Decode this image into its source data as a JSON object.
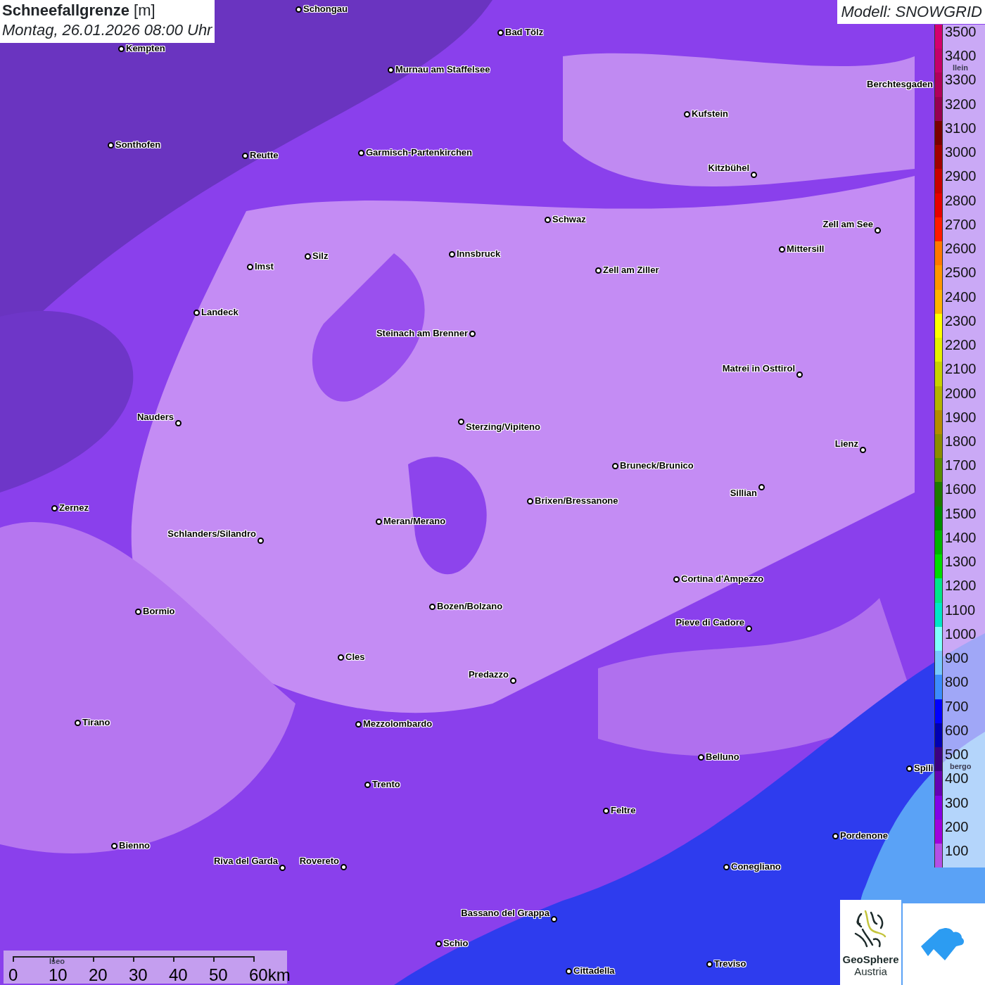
{
  "header": {
    "title": "**Schneefallgrenze** [m]",
    "subtitle": "Montag, 26.01.2026 08:00 Uhr"
  },
  "model": "Modell: SNOWGRID",
  "cities": [
    {
      "name": "Schongau"
    },
    {
      "name": "Kempten"
    },
    {
      "name": "Bad Tölz"
    },
    {
      "name": "Murnau am Staffelsee"
    },
    {
      "name": "Berchtesgaden"
    },
    {
      "name": "Kufstein"
    },
    {
      "name": "Sonthofen"
    },
    {
      "name": "Reutte"
    },
    {
      "name": "Garmisch-Partenkirchen"
    },
    {
      "name": "Kitzbühel"
    },
    {
      "name": "Schwaz"
    },
    {
      "name": "Zell am See"
    },
    {
      "name": "Mittersill"
    },
    {
      "name": "Innsbruck"
    },
    {
      "name": "Silz"
    },
    {
      "name": "Imst"
    },
    {
      "name": "Zell am Ziller"
    },
    {
      "name": "Landeck"
    },
    {
      "name": "Steinach am Brenner"
    },
    {
      "name": "Matrei in Osttirol"
    },
    {
      "name": "Nauders"
    },
    {
      "name": "Sterzing/Vipiteno"
    },
    {
      "name": "Lienz"
    },
    {
      "name": "Bruneck/Brunico"
    },
    {
      "name": "Sillian"
    },
    {
      "name": "Brixen/Bressanone"
    },
    {
      "name": "Zernez"
    },
    {
      "name": "Meran/Merano"
    },
    {
      "name": "Schlanders/Silandro"
    },
    {
      "name": "Cortina d'Ampezzo"
    },
    {
      "name": "Bozen/Bolzano"
    },
    {
      "name": "Bormio"
    },
    {
      "name": "Pieve di Cadore"
    },
    {
      "name": "Cles"
    },
    {
      "name": "Predazzo"
    },
    {
      "name": "Tirano"
    },
    {
      "name": "Mezzolombardo"
    },
    {
      "name": "Belluno"
    },
    {
      "name": "Spili"
    },
    {
      "name": "Trento"
    },
    {
      "name": "Feltre"
    },
    {
      "name": "Pordenone"
    },
    {
      "name": "Bienno"
    },
    {
      "name": "Riva del Garda"
    },
    {
      "name": "Rovereto"
    },
    {
      "name": "Conegliano"
    },
    {
      "name": "Bassano del Grappa"
    },
    {
      "name": "Schio"
    },
    {
      "name": "Treviso"
    },
    {
      "name": "Cittadella"
    }
  ],
  "faded_labels": [
    "llein",
    "bergo",
    "Iseo"
  ],
  "legend": [
    {
      "label": "3500",
      "color": "#d4006e"
    },
    {
      "label": "3400",
      "color": "#c4006a"
    },
    {
      "label": "3300",
      "color": "#b0005c"
    },
    {
      "label": "3200",
      "color": "#960050"
    },
    {
      "label": "3100",
      "color": "#7a0000"
    },
    {
      "label": "3000",
      "color": "#a00000"
    },
    {
      "label": "2900",
      "color": "#c80000"
    },
    {
      "label": "2800",
      "color": "#e60000"
    },
    {
      "label": "2700",
      "color": "#ff1a00"
    },
    {
      "label": "2600",
      "color": "#ff7800"
    },
    {
      "label": "2500",
      "color": "#ff9600"
    },
    {
      "label": "2400",
      "color": "#ffb400"
    },
    {
      "label": "2300",
      "color": "#ffff00"
    },
    {
      "label": "2200",
      "color": "#e6f000"
    },
    {
      "label": "2100",
      "color": "#c8d200"
    },
    {
      "label": "2000",
      "color": "#b4b400"
    },
    {
      "label": "1900",
      "color": "#b48c00"
    },
    {
      "label": "1800",
      "color": "#8c8c00"
    },
    {
      "label": "1700",
      "color": "#5a8c00"
    },
    {
      "label": "1600",
      "color": "#1e7800"
    },
    {
      "label": "1500",
      "color": "#008c00"
    },
    {
      "label": "1400",
      "color": "#00b400"
    },
    {
      "label": "1300",
      "color": "#00dc00"
    },
    {
      "label": "1200",
      "color": "#00e68c"
    },
    {
      "label": "1100",
      "color": "#00e6c8"
    },
    {
      "label": "1000",
      "color": "#80ffff"
    },
    {
      "label": "900",
      "color": "#78c8ff"
    },
    {
      "label": "800",
      "color": "#3c8cff"
    },
    {
      "label": "700",
      "color": "#0000ff"
    },
    {
      "label": "600",
      "color": "#0000b4"
    },
    {
      "label": "500",
      "color": "#3c0082"
    },
    {
      "label": "400",
      "color": "#6400b4"
    },
    {
      "label": "300",
      "color": "#8200e6"
    },
    {
      "label": "200",
      "color": "#a000dc"
    },
    {
      "label": "100",
      "color": "#b450e6"
    }
  ],
  "scale_bar": {
    "labels": [
      "0",
      "10",
      "20",
      "30",
      "40",
      "50",
      "60km"
    ]
  },
  "logo": {
    "name": "GeoSphere",
    "country": "Austria"
  }
}
